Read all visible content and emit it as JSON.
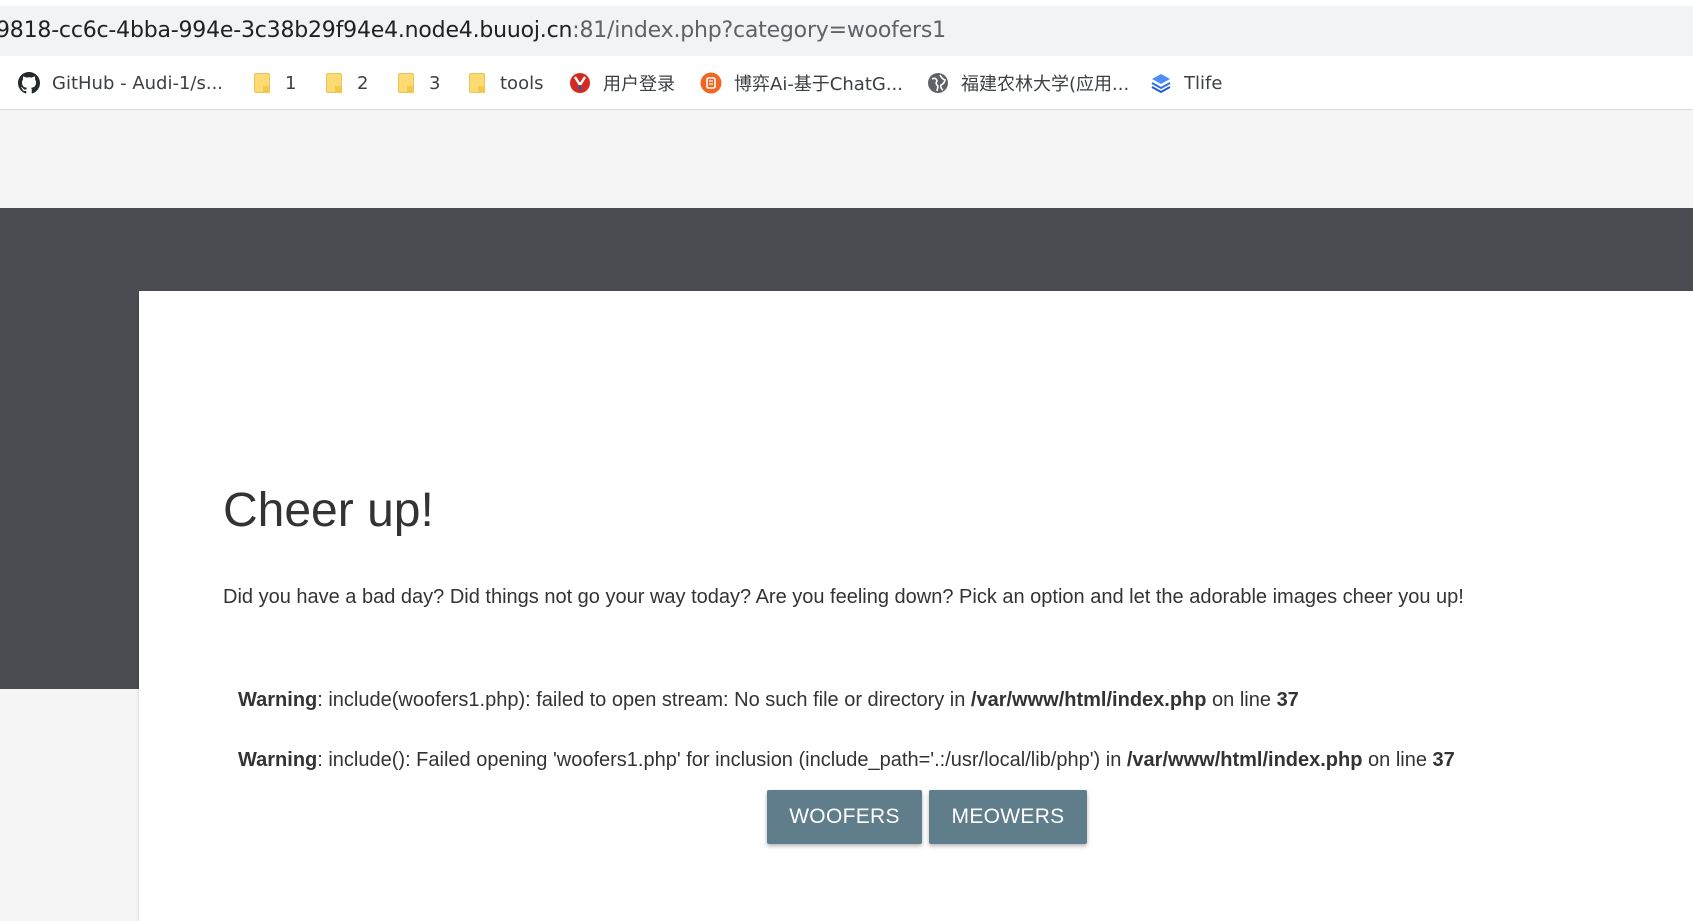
{
  "address_bar": {
    "host": "9818-cc6c-4bba-994e-3c38b29f94e4.node4.buuoj.cn",
    "path": ":81/index.php?category=woofers1"
  },
  "bookmarks": [
    {
      "label": "GitHub - Audi-1/s...",
      "icon": "github-icon"
    },
    {
      "label": "1",
      "icon": "folder-icon"
    },
    {
      "label": "2",
      "icon": "folder-icon"
    },
    {
      "label": "3",
      "icon": "folder-icon"
    },
    {
      "label": "tools",
      "icon": "folder-icon"
    },
    {
      "label": "用户登录",
      "icon": "site-icon"
    },
    {
      "label": "博弈Ai-基于ChatG...",
      "icon": "site-icon"
    },
    {
      "label": "福建农林大学(应用...",
      "icon": "globe-icon"
    },
    {
      "label": "Tlife",
      "icon": "layers-icon"
    }
  ],
  "page": {
    "title": "Cheer up!",
    "description": "Did you have a bad day? Did things not go your way today? Are you feeling down? Pick an option and let the adorable images cheer you up!"
  },
  "warnings": [
    {
      "label": "Warning",
      "message": ": include(woofers1.php): failed to open stream: No such file or directory in ",
      "file": "/var/www/html/index.php",
      "line_text": " on line ",
      "line": "37"
    },
    {
      "label": "Warning",
      "message": ": include(): Failed opening 'woofers1.php' for inclusion (include_path='.:/usr/local/lib/php') in ",
      "file": "/var/www/html/index.php",
      "line_text": " on line ",
      "line": "37"
    }
  ],
  "buttons": {
    "woofers": "WOOFERS",
    "meowers": "MEOWERS"
  },
  "colors": {
    "dark_band": "#4a4c51",
    "button": "#607d8b"
  }
}
